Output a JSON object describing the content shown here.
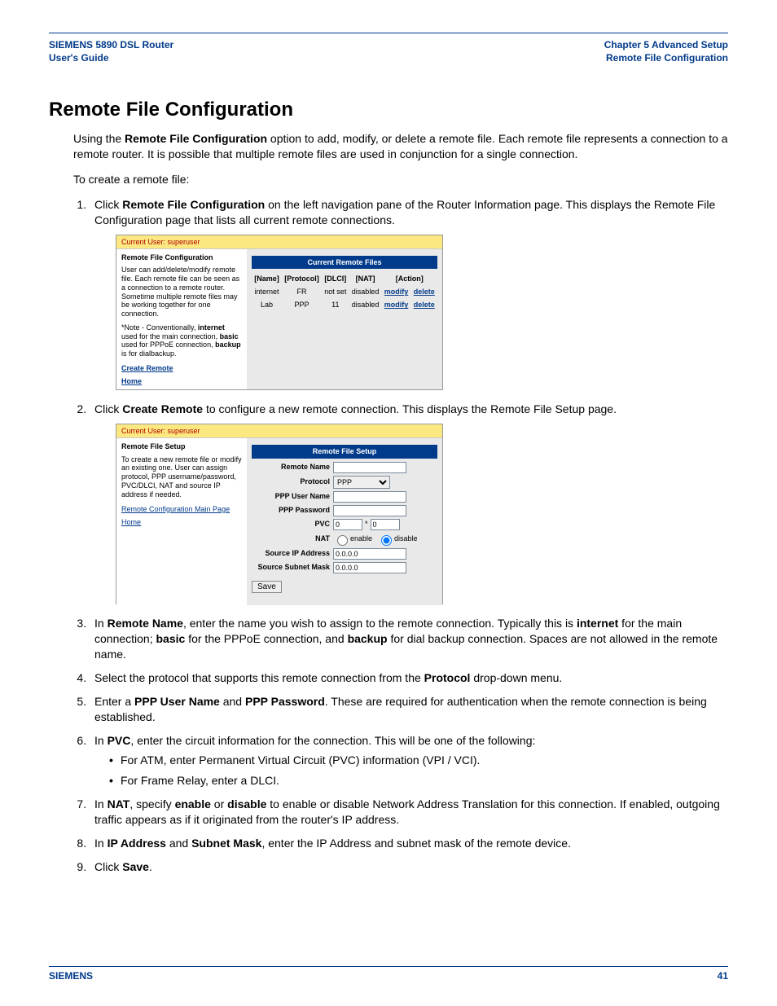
{
  "header": {
    "left_line1": "SIEMENS 5890 DSL Router",
    "left_line2": "User's Guide",
    "right_line1": "Chapter 5  Advanced Setup",
    "right_line2": "Remote File Configuration"
  },
  "title": "Remote File Configuration",
  "intro": {
    "p1_pre": "Using the ",
    "p1_bold": "Remote File Configuration",
    "p1_post": " option to add, modify, or delete a remote file. Each remote file represents a connection to a remote router. It is possible that multiple remote files are used in conjunction for a single connection.",
    "p2": "To create a remote file:"
  },
  "steps": {
    "s1_pre": "Click ",
    "s1_bold": "Remote File Configuration",
    "s1_post": " on the left navigation pane of the Router Information page. This displays the Remote File Configuration page that lists all current remote connections.",
    "s2_pre": "Click ",
    "s2_bold": "Create Remote",
    "s2_post": " to configure a new remote connection. This displays the Remote File Setup page.",
    "s3_a": "In ",
    "s3_b1": "Remote Name",
    "s3_b": ", enter the name you wish to assign to the remote connection. Typically this is ",
    "s3_b2": "internet",
    "s3_c": " for the main connection; ",
    "s3_b3": "basic",
    "s3_d": " for the PPPoE connection, and ",
    "s3_b4": "backup",
    "s3_e": " for dial backup connection. Spaces are not allowed in the remote name.",
    "s4_a": "Select the protocol that supports this remote connection from the ",
    "s4_b": "Protocol",
    "s4_c": " drop-down menu.",
    "s5_a": "Enter a ",
    "s5_b1": "PPP User Name",
    "s5_b": " and ",
    "s5_b2": "PPP Password",
    "s5_c": ". These are required for authentication when the remote connection is being established.",
    "s6_a": "In ",
    "s6_b": "PVC",
    "s6_c": ", enter the circuit information for the connection. This will be one of the following:",
    "s6_bul1": "For ATM, enter Permanent Virtual Circuit (PVC) information (VPI / VCI).",
    "s6_bul2": "For Frame Relay, enter a DLCI.",
    "s7_a": "In ",
    "s7_b1": "NAT",
    "s7_b": ", specify ",
    "s7_b2": "enable",
    "s7_c": " or ",
    "s7_b3": "disable",
    "s7_d": " to enable or disable Network Address Translation for this connection. If enabled, outgoing traffic appears as if it originated from the router's IP address.",
    "s8_a": "In ",
    "s8_b1": "IP Address",
    "s8_b": " and ",
    "s8_b2": "Subnet Mask",
    "s8_c": ", enter the IP Address and subnet mask of the remote device.",
    "s9_a": "Click ",
    "s9_b": "Save",
    "s9_c": "."
  },
  "shot1": {
    "userbar": "Current User: superuser",
    "title": "Remote File Configuration",
    "desc": "User can add/delete/modify remote file. Each remote file can be seen as a connection to a remote router. Sometime multiple remote files may be working together for one connection.",
    "note_a": "*Note - Conventionally, ",
    "note_b1": "internet",
    "note_b": " used for the main connection, ",
    "note_b2": "basic",
    "note_c": " used for PPPoE connection, ",
    "note_b3": "backup",
    "note_d": " is for dialbackup.",
    "link_create": "Create Remote",
    "link_home": "Home",
    "table_title": "Current Remote Files",
    "th_name": "[Name]",
    "th_proto": "[Protocol]",
    "th_dlci": "[DLCI]",
    "th_nat": "[NAT]",
    "th_action": "[Action]",
    "rows": [
      {
        "name": "internet",
        "proto": "FR",
        "dlci": "not set",
        "nat": "disabled",
        "a1": "modify",
        "a2": "delete"
      },
      {
        "name": "Lab",
        "proto": "PPP",
        "dlci": "11",
        "nat": "disabled",
        "a1": "modify",
        "a2": "delete"
      }
    ]
  },
  "shot2": {
    "userbar": "Current User: superuser",
    "title": "Remote File Setup",
    "desc": "To create a new remote file or modify an existing one. User can assign protocol, PPP username/password, PVC/DLCI, NAT and source IP address if needed.",
    "link_main": "Remote Configuration Main Page",
    "link_home": "Home",
    "panel_title": "Remote File Setup",
    "lbl_name": "Remote Name",
    "lbl_proto": "Protocol",
    "val_proto": "PPP",
    "lbl_user": "PPP User Name",
    "lbl_pass": "PPP Password",
    "lbl_pvc": "PVC",
    "val_pvc1": "0",
    "sep": "*",
    "val_pvc2": "0",
    "lbl_nat": "NAT",
    "opt_enable": "enable",
    "opt_disable": "disable",
    "lbl_srcip": "Source IP Address",
    "val_srcip": "0.0.0.0",
    "lbl_srcmask": "Source Subnet Mask",
    "val_srcmask": "0.0.0.0",
    "btn_save": "Save"
  },
  "footer": {
    "brand": "SIEMENS",
    "page": "41"
  }
}
